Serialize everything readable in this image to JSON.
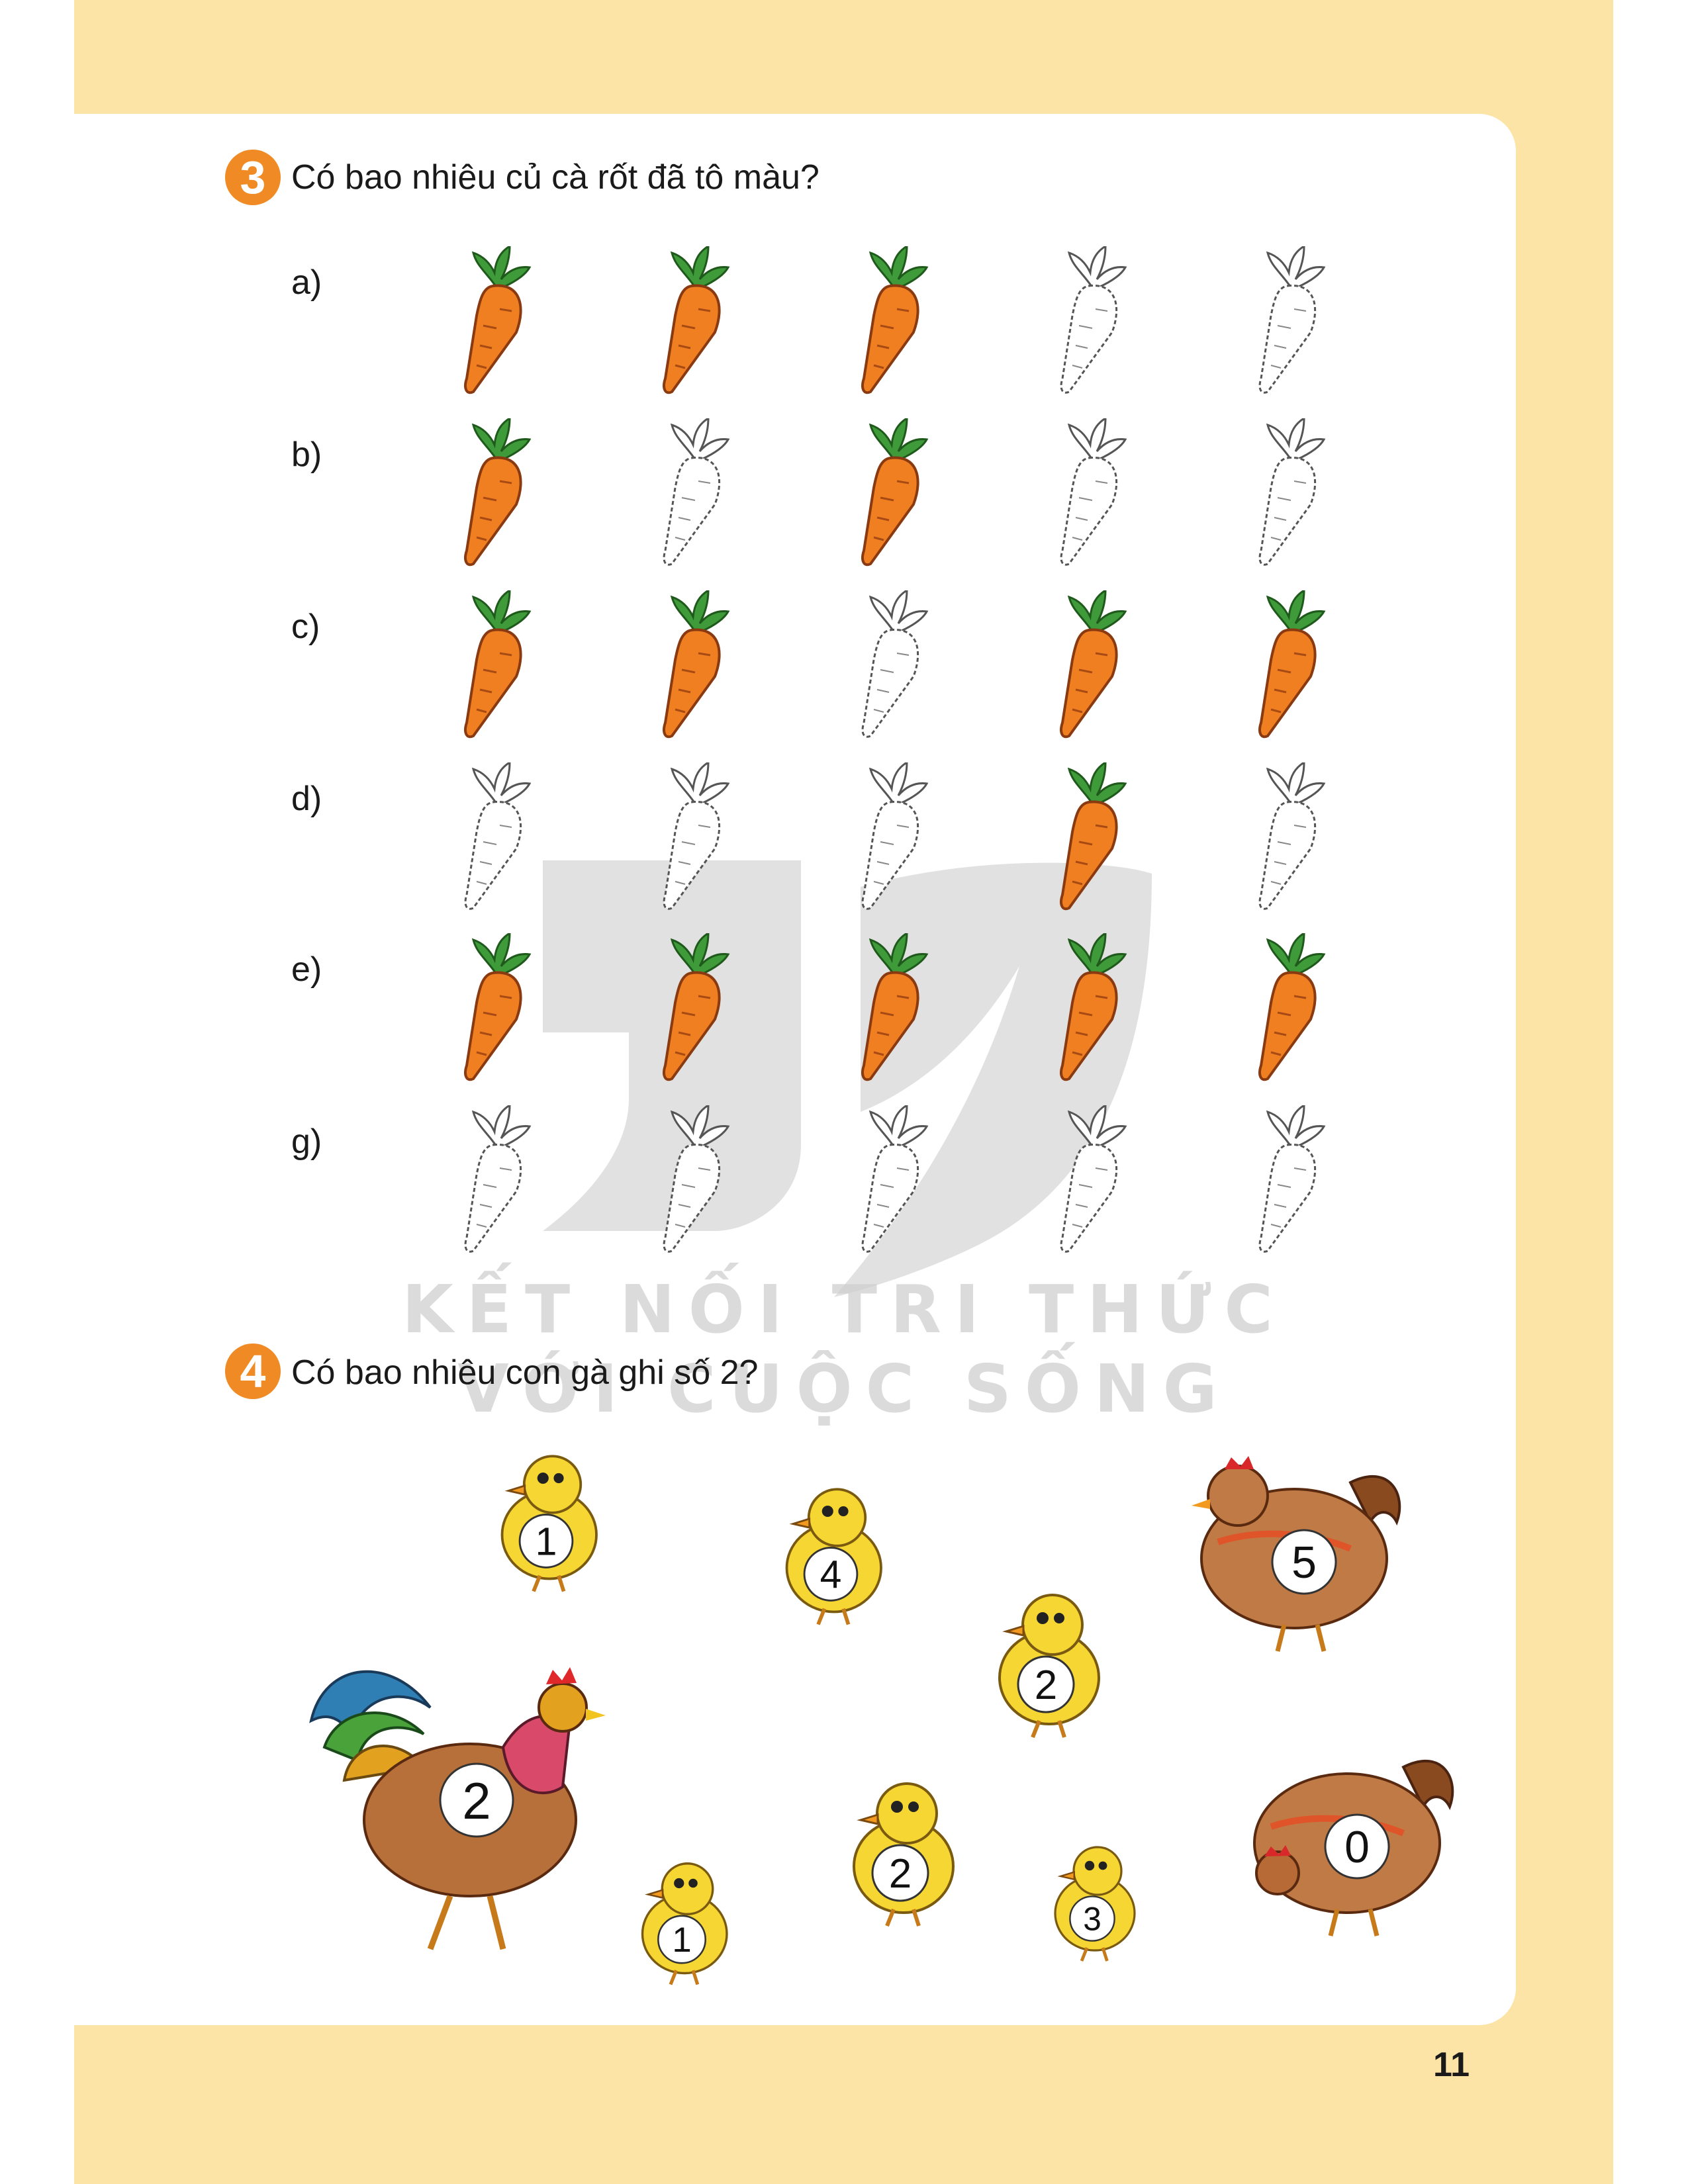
{
  "question3": {
    "number": "3",
    "text": "Có bao nhiêu củ cà rốt đã tô màu?",
    "rows": [
      {
        "label": "a)",
        "colored": [
          true,
          true,
          true,
          false,
          false
        ]
      },
      {
        "label": "b)",
        "colored": [
          true,
          false,
          true,
          false,
          false
        ]
      },
      {
        "label": "c)",
        "colored": [
          true,
          true,
          false,
          true,
          true
        ]
      },
      {
        "label": "d)",
        "colored": [
          false,
          false,
          false,
          true,
          false
        ]
      },
      {
        "label": "e)",
        "colored": [
          true,
          true,
          true,
          true,
          true
        ]
      },
      {
        "label": "g)",
        "colored": [
          false,
          false,
          false,
          false,
          false
        ]
      }
    ]
  },
  "question4": {
    "number": "4",
    "text": "Có bao nhiêu con gà ghi số 2?",
    "animals": [
      {
        "kind": "chick",
        "number": "1"
      },
      {
        "kind": "chick",
        "number": "4"
      },
      {
        "kind": "hen",
        "number": "5"
      },
      {
        "kind": "chick",
        "number": "2"
      },
      {
        "kind": "rooster",
        "number": "2"
      },
      {
        "kind": "chick",
        "number": "1"
      },
      {
        "kind": "chick",
        "number": "2"
      },
      {
        "kind": "chick",
        "number": "3"
      },
      {
        "kind": "hen-pecking",
        "number": "0"
      }
    ]
  },
  "watermark": {
    "line1": "KẾT NỐI TRI THỨC",
    "line2": "VỚI CUỘC SỐNG"
  },
  "page_number": "11",
  "colors": {
    "frame": "#fce4a6",
    "accent": "#f08a24",
    "carrot": "#f07f22",
    "leaf": "#3f9a3a"
  }
}
